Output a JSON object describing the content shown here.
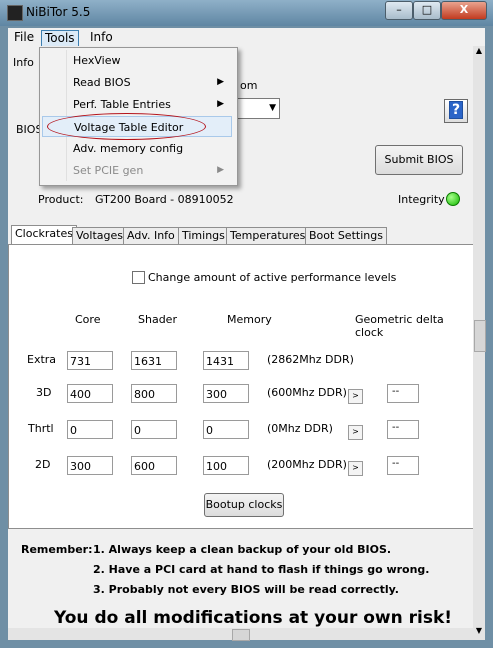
{
  "window": {
    "title": "NiBiTor 5.5",
    "close_label": "X",
    "min_label": "–",
    "max_label": "□"
  },
  "menubar": {
    "file": "File",
    "tools": "Tools",
    "info": "Info"
  },
  "tools_menu": {
    "items": [
      {
        "label": "HexView",
        "submenu": false,
        "enabled": true
      },
      {
        "label": "Read BIOS",
        "submenu": true,
        "enabled": true
      },
      {
        "label": "Perf. Table Entries",
        "submenu": true,
        "enabled": true
      },
      {
        "label": "Voltage Table Editor",
        "submenu": false,
        "enabled": true,
        "highlighted": true
      },
      {
        "label": "Adv. memory config",
        "submenu": false,
        "enabled": true
      },
      {
        "label": "Set PCIE gen",
        "submenu": true,
        "enabled": false
      }
    ],
    "submenu_arrow": "▶",
    "annotation_color": "#b4141c"
  },
  "top": {
    "info_label": "Info",
    "bios_label": "BIOS",
    "mem_label": "om",
    "mem_select_value": "",
    "help_label": "?",
    "submit_label": "Submit BIOS",
    "product_label": "Product:",
    "product_value": "GT200 Board - 08910052",
    "integrity_label": "Integrity :",
    "integrity_color": "#13b800"
  },
  "tabs": [
    {
      "label": "Clockrates",
      "active": true
    },
    {
      "label": "Voltages"
    },
    {
      "label": "Adv. Info"
    },
    {
      "label": "Timings"
    },
    {
      "label": "Temperatures"
    },
    {
      "label": "Boot Settings"
    }
  ],
  "clockrates": {
    "checkbox_label": "Change amount of active performance levels",
    "checkbox_checked": false,
    "columns": {
      "core": "Core",
      "shader": "Shader",
      "memory": "Memory",
      "geo": "Geometric delta clock"
    },
    "rows": [
      {
        "label": "Extra",
        "core": "731",
        "shader": "1631",
        "memory": "1431",
        "ddr": "(2862Mhz DDR)",
        "has_geo": false
      },
      {
        "label": "3D",
        "core": "400",
        "shader": "800",
        "memory": "300",
        "ddr": "(600Mhz DDR)",
        "has_geo": true,
        "geo": "--"
      },
      {
        "label": "Thrtl",
        "core": "0",
        "shader": "0",
        "memory": "0",
        "ddr": "(0Mhz DDR)",
        "has_geo": true,
        "geo": "--"
      },
      {
        "label": "2D",
        "core": "300",
        "shader": "600",
        "memory": "100",
        "ddr": "(200Mhz DDR)",
        "has_geo": true,
        "geo": "--"
      }
    ],
    "bootup_label": "Bootup clocks",
    "arrow_glyph": ">"
  },
  "reminder": {
    "title": "Remember:",
    "lines": [
      "1. Always keep a clean backup of your old BIOS.",
      "2. Have a PCI card at hand to flash if things go wrong.",
      "3. Probably not every BIOS will be read correctly."
    ],
    "warning": "You do all modifications at your own risk!"
  }
}
